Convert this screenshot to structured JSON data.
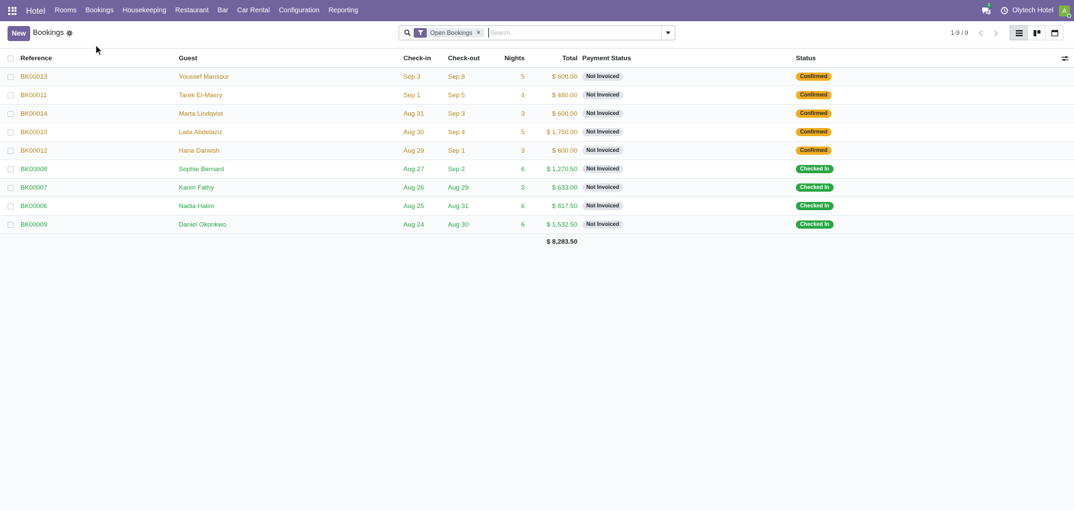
{
  "navbar": {
    "brand": "Hotel",
    "menu": [
      "Rooms",
      "Bookings",
      "Housekeeping",
      "Restaurant",
      "Bar",
      "Car Rental",
      "Configuration",
      "Reporting"
    ],
    "chat_count": "3",
    "company": "Olytech Hotel",
    "avatar_letter": "A"
  },
  "control": {
    "new_label": "New",
    "title": "Bookings",
    "facet_label": "Open Bookings",
    "facet_close": "×",
    "search_placeholder": "Search...",
    "pager": "1-9 / 9"
  },
  "table": {
    "headers": {
      "reference": "Reference",
      "guest": "Guest",
      "checkin": "Check-in",
      "checkout": "Check-out",
      "nights": "Nights",
      "total": "Total",
      "payment_status": "Payment Status",
      "status": "Status"
    },
    "rows": [
      {
        "ref": "BK00013",
        "guest": "Youssef Mansour",
        "in": "Sep 3",
        "out": "Sep 8",
        "nights": "5",
        "total": "$ 600.00",
        "payment": "Not Invoiced",
        "status": "Confirmed",
        "tone": "gold"
      },
      {
        "ref": "BK00011",
        "guest": "Tarek El-Masry",
        "in": "Sep 1",
        "out": "Sep 5",
        "nights": "4",
        "total": "$ 480.00",
        "payment": "Not Invoiced",
        "status": "Confirmed",
        "tone": "gold"
      },
      {
        "ref": "BK00014",
        "guest": "Marta Lindqvist",
        "in": "Aug 31",
        "out": "Sep 3",
        "nights": "3",
        "total": "$ 600.00",
        "payment": "Not Invoiced",
        "status": "Confirmed",
        "tone": "gold"
      },
      {
        "ref": "BK00010",
        "guest": "Laila Abdelaziz",
        "in": "Aug 30",
        "out": "Sep 4",
        "nights": "5",
        "total": "$ 1,750.00",
        "payment": "Not Invoiced",
        "status": "Confirmed",
        "tone": "gold"
      },
      {
        "ref": "BK00012",
        "guest": "Hana Darwish",
        "in": "Aug 29",
        "out": "Sep 1",
        "nights": "3",
        "total": "$ 600.00",
        "payment": "Not Invoiced",
        "status": "Confirmed",
        "tone": "gold"
      },
      {
        "ref": "BK00008",
        "guest": "Sophie Bernard",
        "in": "Aug 27",
        "out": "Sep 2",
        "nights": "6",
        "total": "$ 1,270.50",
        "payment": "Not Invoiced",
        "status": "Checked In",
        "tone": "green"
      },
      {
        "ref": "BK00007",
        "guest": "Karim Fathy",
        "in": "Aug 26",
        "out": "Aug 29",
        "nights": "3",
        "total": "$ 633.00",
        "payment": "Not Invoiced",
        "status": "Checked In",
        "tone": "green"
      },
      {
        "ref": "BK00006",
        "guest": "Nadia Halim",
        "in": "Aug 25",
        "out": "Aug 31",
        "nights": "6",
        "total": "$ 817.50",
        "payment": "Not Invoiced",
        "status": "Checked In",
        "tone": "green"
      },
      {
        "ref": "BK00009",
        "guest": "Daniel Okonkwo",
        "in": "Aug 24",
        "out": "Aug 30",
        "nights": "6",
        "total": "$ 1,532.50",
        "payment": "Not Invoiced",
        "status": "Checked In",
        "tone": "green"
      }
    ],
    "grand_total": "$ 8,283.50"
  },
  "colors": {
    "brand": "#71639e",
    "confirmed": "#f0ad1d",
    "checked_in": "#28a745",
    "gold_text": "#b6871d",
    "green_text": "#28a745"
  }
}
